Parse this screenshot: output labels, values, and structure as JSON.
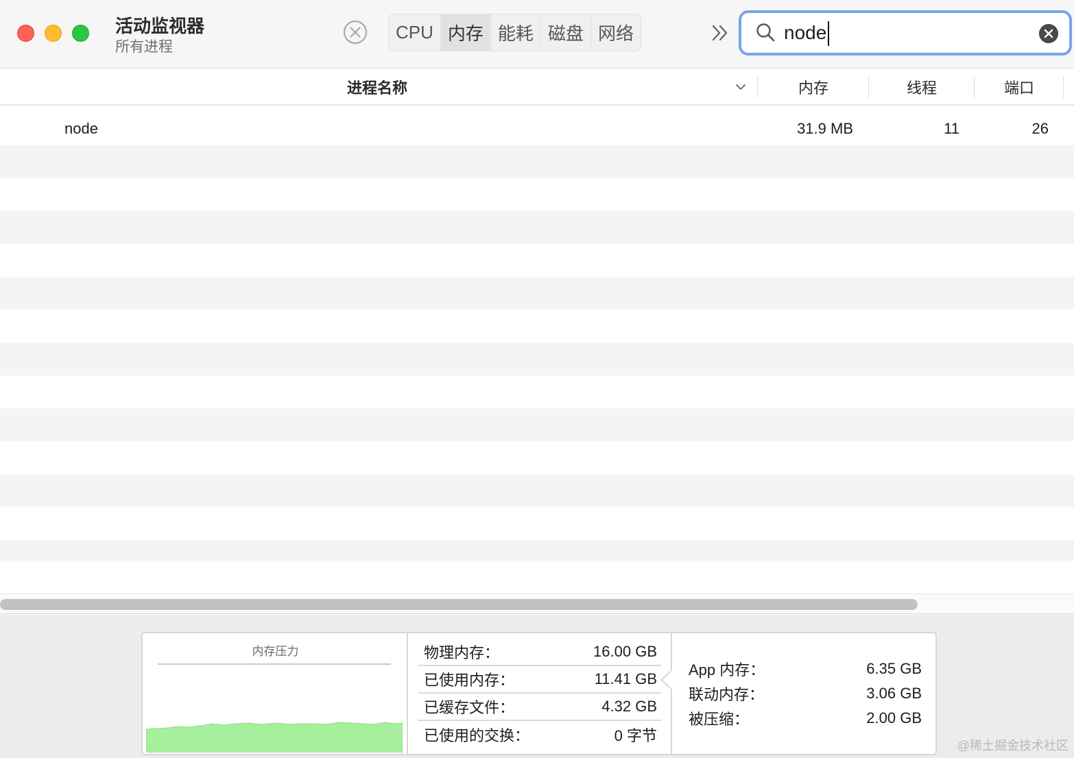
{
  "app": {
    "title": "活动监视器",
    "subtitle": "所有进程"
  },
  "toolbar": {
    "tabs": [
      {
        "label": "CPU",
        "active": false
      },
      {
        "label": "内存",
        "active": true
      },
      {
        "label": "能耗",
        "active": false
      },
      {
        "label": "磁盘",
        "active": false
      },
      {
        "label": "网络",
        "active": false
      }
    ],
    "search": {
      "value": "node"
    }
  },
  "table": {
    "columns": {
      "name": "进程名称",
      "memory": "内存",
      "threads": "线程",
      "ports": "端口"
    },
    "rows": [
      {
        "name": "node",
        "memory": "31.9 MB",
        "threads": "11",
        "ports": "26"
      }
    ]
  },
  "memory_panel": {
    "pressure_title": "内存压力",
    "pressure_color": "#a6ef9c",
    "stats": [
      {
        "label": "物理内存：",
        "value": "16.00 GB"
      },
      {
        "label": "已使用内存：",
        "value": "11.41 GB"
      },
      {
        "label": "已缓存文件：",
        "value": "4.32 GB"
      },
      {
        "label": "已使用的交换：",
        "value": "0 字节"
      }
    ],
    "details": [
      {
        "label": "App 内存：",
        "value": "6.35 GB"
      },
      {
        "label": "联动内存：",
        "value": "3.06 GB"
      },
      {
        "label": "被压缩：",
        "value": "2.00 GB"
      }
    ]
  },
  "watermark": "@稀土掘金技术社区",
  "colors": {
    "search_focus": "#78a4ea",
    "close": "#fe5f57",
    "minimize": "#febc2e",
    "zoom": "#28c840"
  }
}
